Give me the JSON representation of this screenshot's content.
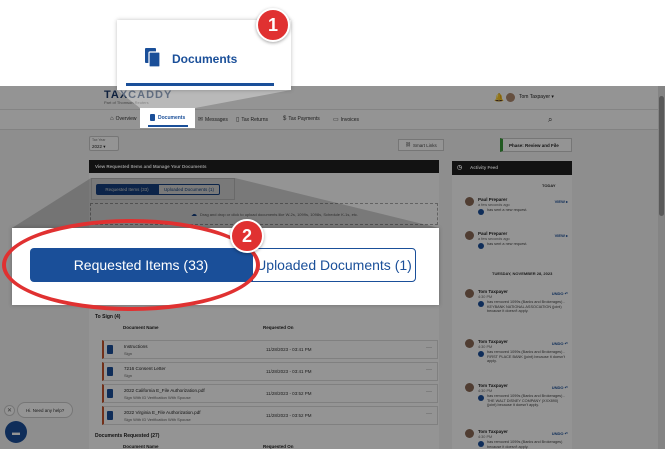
{
  "callout_1": {
    "number": "1",
    "label": "Documents",
    "icon": "documents-icon"
  },
  "callout_2": {
    "number": "2",
    "tab_active": "Requested Items (33)",
    "tab_inactive": "Uploaded Documents (1)"
  },
  "app": {
    "logo": "TAXCADDY",
    "logo_sub": "Part of Thomson Reuters",
    "user_name": "Tom Taxpayer",
    "nav": [
      {
        "label": "Overview",
        "icon": "home-icon"
      },
      {
        "label": "Documents",
        "icon": "documents-icon"
      },
      {
        "label": "Messages",
        "icon": "chat-icon"
      },
      {
        "label": "Tax Returns",
        "icon": "file-icon"
      },
      {
        "label": "Tax Payments",
        "icon": "dollar-icon"
      },
      {
        "label": "Invoices",
        "icon": "invoice-icon"
      }
    ],
    "tax_year_label": "Tax Year",
    "tax_year_value": "2022",
    "smart_links": "Smart Links",
    "phase": "Phase: Review and File",
    "main_header": "View Requested Items and Manage Your Documents",
    "mini_tab_active": "Requested Items (33)",
    "mini_tab_inactive": "Uploaded Documents (1)",
    "dropzone_text": "Drag and drop or click to upload documents like W-2s, 1099s, 1098s, Schedule K-1s, etc.",
    "to_sign_title": "To Sign  (4)",
    "col_document_name": "Document Name",
    "col_requested_on": "Requested On",
    "documents_requested_title": "Documents Requested  (27)",
    "to_sign_rows": [
      {
        "name": "Instructions",
        "sub": "Sign",
        "date": "11/28/2023 - 03:41 PM"
      },
      {
        "name": "7216 Consent Letter",
        "sub": "Sign",
        "date": "11/28/2023 - 03:41 PM"
      },
      {
        "name": "2022 California E_File Authorization.pdf",
        "sub": "Sign With ID Verification With Spouse",
        "date": "11/28/2023 - 03:52 PM"
      },
      {
        "name": "2022 Virginia E_File Authorization.pdf",
        "sub": "Sign With ID Verification With Spouse",
        "date": "11/28/2023 - 03:52 PM"
      }
    ],
    "requested_rows_col_name": "Document Name",
    "requested_rows_col_date": "Requested On",
    "activity_feed": "Activity Feed",
    "feed_today": "TODAY",
    "feed_date2": "TUESDAY, NOVEMBER 28, 2023",
    "feed_entries": [
      {
        "who": "Paul Preparer",
        "when": "a few seconds ago",
        "action": "VIEW",
        "msg": "has sent a new request."
      },
      {
        "who": "Paul Preparer",
        "when": "a few seconds ago",
        "action": "VIEW",
        "msg": "has sent a new request."
      },
      {
        "who": "Tom Taxpayer",
        "when": "4:30 PM",
        "action": "UNDO",
        "msg": "has removed 1099s (Banks and Brokerages) - KEYBANK NATIONAL ASSOCIATION (joint) because it doesn't apply."
      },
      {
        "who": "Tom Taxpayer",
        "when": "4:30 PM",
        "action": "UNDO",
        "msg": "has removed 1099s (Banks and Brokerages) - FIRST PLACE BANK (joint) because it doesn't apply."
      },
      {
        "who": "Tom Taxpayer",
        "when": "4:30 PM",
        "action": "UNDO",
        "msg": "has removed 1099s (Banks and Brokerages) - THE WALT DISNEY COMPANY (XXX890) (joint) because it doesn't apply."
      },
      {
        "who": "Tom Taxpayer",
        "when": "4:30 PM",
        "action": "UNDO",
        "msg": "has removed 1099s (Banks and Brokerages) because it doesn't apply."
      }
    ],
    "help_text": "Hi. Need any help?"
  },
  "colors": {
    "brand_blue": "#1a4f99",
    "callout_red": "#e03131",
    "accent_orange": "#c4532b",
    "phase_green": "#3a9a3a"
  }
}
